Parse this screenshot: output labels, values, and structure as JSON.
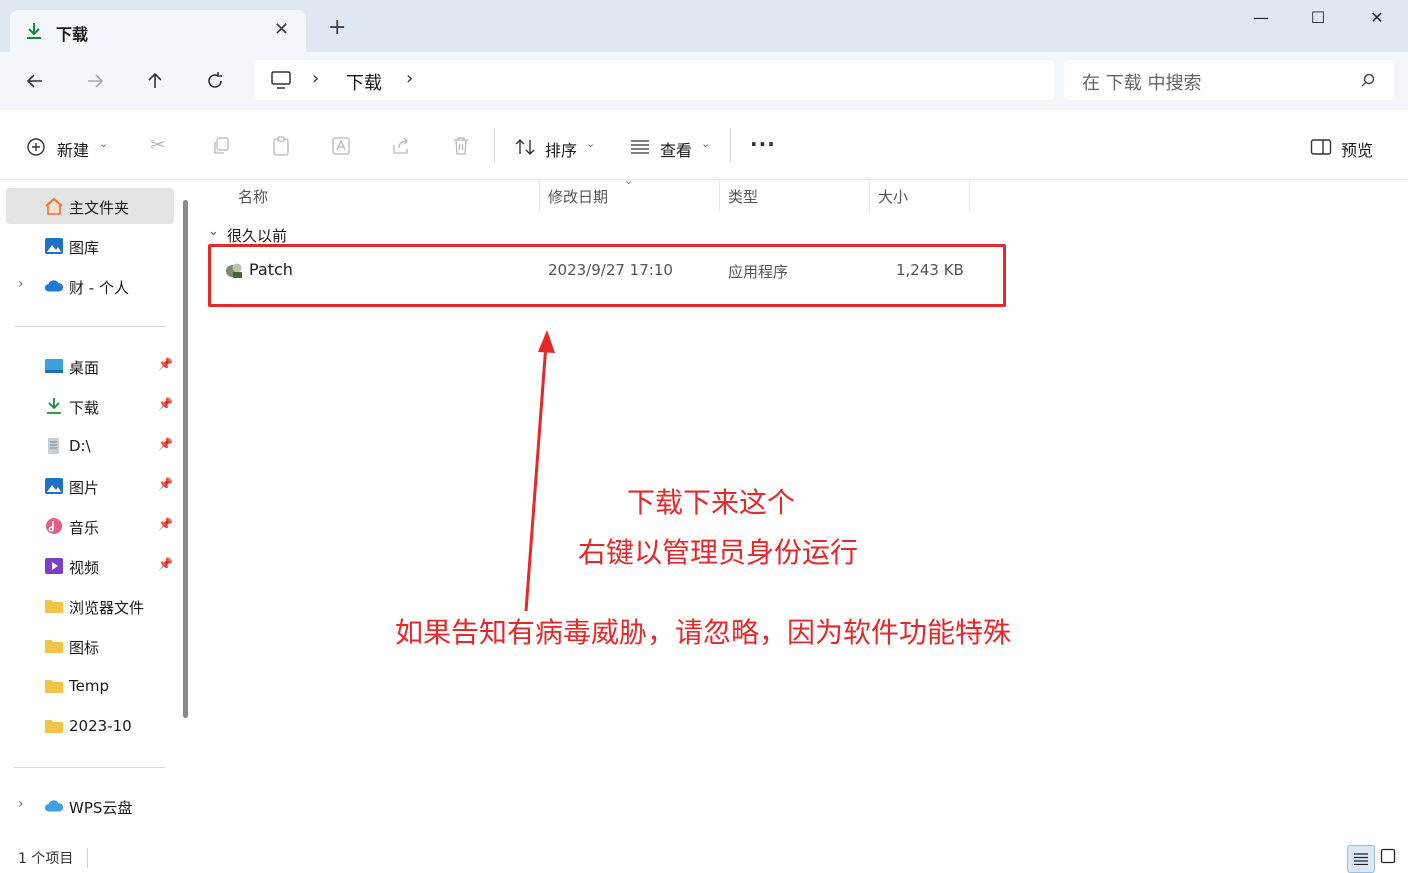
{
  "window": {
    "tab_title": "下载",
    "tab_close": "✕",
    "new_tab": "+",
    "minimize": "—",
    "maximize": "☐",
    "close": "✕"
  },
  "navigation": {
    "breadcrumb_separator": "›",
    "breadcrumb": [
      "下载"
    ],
    "search_placeholder": "在 下载 中搜索"
  },
  "toolbar": {
    "new_label": "新建",
    "sort_label": "排序",
    "view_label": "查看",
    "more_label": "···",
    "preview_label": "预览"
  },
  "sidebar": {
    "quick": [
      {
        "label": "主文件夹",
        "selected": true
      },
      {
        "label": "图库"
      },
      {
        "label": "财 - 个人",
        "expandable": true
      }
    ],
    "pinned": [
      {
        "label": "桌面"
      },
      {
        "label": "下载"
      },
      {
        "label": "D:\\"
      },
      {
        "label": "图片"
      },
      {
        "label": "音乐"
      },
      {
        "label": "视频"
      },
      {
        "label": "浏览器文件"
      },
      {
        "label": "图标"
      },
      {
        "label": "Temp"
      },
      {
        "label": "2023-10"
      }
    ],
    "cloud": [
      {
        "label": "WPS云盘",
        "expandable": true
      }
    ]
  },
  "file_list": {
    "columns": [
      "名称",
      "修改日期",
      "类型",
      "大小"
    ],
    "group": "很久以前",
    "rows": [
      {
        "name": "Patch",
        "modified": "2023/9/27 17:10",
        "type": "应用程序",
        "size": "1,243 KB"
      }
    ]
  },
  "status": {
    "item_count": "1 个项目"
  },
  "annotation": {
    "line1": "下载下来这个",
    "line2": "右键以管理员身份运行",
    "line3": "如果告知有病毒威胁，请忽略，因为软件功能特殊",
    "color": "#e5292b"
  },
  "colors": {
    "titlebar": "#dfe7f3",
    "accent": "#0067c0",
    "highlight_box": "#e5292b"
  }
}
